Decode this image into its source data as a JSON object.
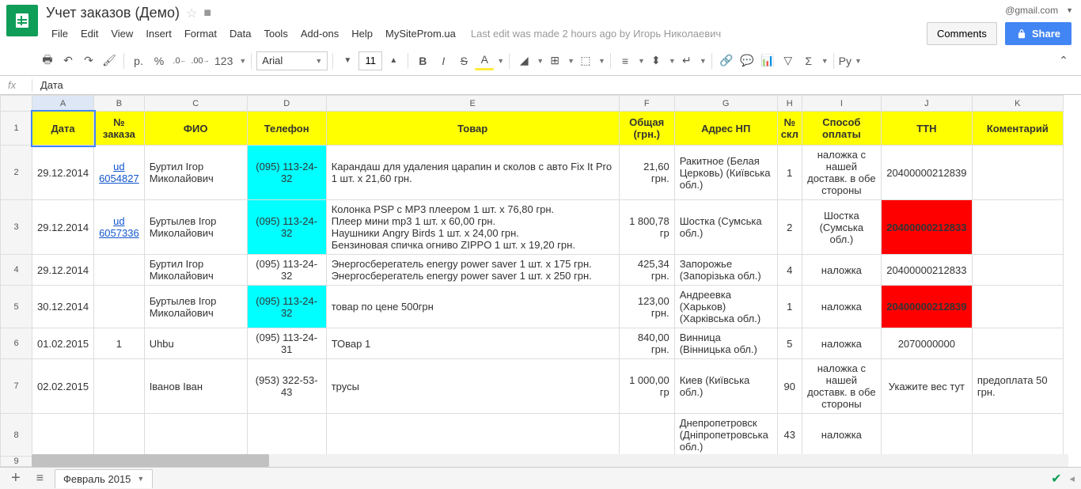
{
  "doc_title": "Учет заказов (Демо)",
  "user_email": "@gmail.com",
  "comments_label": "Comments",
  "share_label": "Share",
  "menu": [
    "File",
    "Edit",
    "View",
    "Insert",
    "Format",
    "Data",
    "Tools",
    "Add-ons",
    "Help",
    "MySiteProm.ua"
  ],
  "last_edit": "Last edit was made 2 hours ago by Игорь Николаевич",
  "font_name": "Arial",
  "font_size": "11",
  "formula_value": "Дата",
  "columns": [
    "A",
    "B",
    "C",
    "D",
    "E",
    "F",
    "G",
    "H",
    "I",
    "J",
    "K"
  ],
  "headers": [
    "Дата",
    "№ заказа",
    "ФИО",
    "Телефон",
    "Товар",
    "Общая (грн.)",
    "Адрес НП",
    "№ скл",
    "Способ оплаты",
    "ТТН",
    "Коментарий"
  ],
  "rows": [
    {
      "n": "2",
      "date": "29.12.2014",
      "order": "ud 6054827",
      "order_link": true,
      "fio": "Буртил Ігор Миколайович",
      "phone": "(095) 113-24-32",
      "phone_cyan": true,
      "goods": "Карандаш для удаления царапин и сколов с авто Fix It Pro 1 шт. x 21,60 грн.",
      "total": "21,60 грн.",
      "addr": "Ракитное (Белая Церковь) (Київська обл.)",
      "skl": "1",
      "pay": "наложка с нашей доставк. в обе стороны",
      "ttn": "20400000212839",
      "ttn_red": false,
      "comment": ""
    },
    {
      "n": "3",
      "date": "29.12.2014",
      "order": "ud 6057336",
      "order_link": true,
      "fio": "Буртылев Ігор Миколайович",
      "phone": "(095) 113-24-32",
      "phone_cyan": true,
      "goods": "Колонка PSP с MP3 плеером 1 шт. x 76,80 грн.\nПлеер мини mp3 1 шт. x 60,00 грн.\nНаушники Angry Birds 1 шт. x 24,00 грн.\nБензиновая спичка огниво ZIPPO 1 шт. x 19,20 грн.",
      "total": "1 800,78 гр",
      "addr": "Шостка (Сумська обл.)",
      "skl": "2",
      "pay": "Шостка (Сумська обл.)",
      "ttn": "20400000212833",
      "ttn_red": true,
      "comment": ""
    },
    {
      "n": "4",
      "date": "29.12.2014",
      "order": "",
      "order_link": false,
      "fio": "Буртил Ігор Миколайович",
      "phone": "(095) 113-24-32",
      "phone_cyan": false,
      "goods": "Энергосберегатель energy power saver 1 шт. x 175 грн.\nЭнергосберегатель energy power saver 1 шт. x 250 грн.",
      "total": "425,34 грн.",
      "addr": "Запорожье (Запорізька обл.)",
      "skl": "4",
      "pay": "наложка",
      "ttn": "20400000212833",
      "ttn_red": false,
      "comment": ""
    },
    {
      "n": "5",
      "date": "30.12.2014",
      "order": "",
      "order_link": false,
      "fio": "Буртылев Ігор Миколайович",
      "phone": "(095) 113-24-32",
      "phone_cyan": true,
      "goods": "товар по цене 500грн",
      "total": "123,00 грн.",
      "addr": "Андреевка (Харьков) (Харківська обл.)",
      "skl": "1",
      "pay": "наложка",
      "ttn": "20400000212839",
      "ttn_red": true,
      "comment": ""
    },
    {
      "n": "6",
      "date": "01.02.2015",
      "order": "1",
      "order_link": false,
      "fio": "Uhbu",
      "phone": "(095) 113-24-31",
      "phone_cyan": false,
      "goods": "ТОвар 1",
      "total": "840,00 грн.",
      "addr": "Винница (Вінницька обл.)",
      "skl": "5",
      "pay": "наложка",
      "ttn": "2070000000",
      "ttn_red": false,
      "comment": ""
    },
    {
      "n": "7",
      "date": "02.02.2015",
      "order": "",
      "order_link": false,
      "fio": "Іванов Іван",
      "phone": "(953) 322-53-43",
      "phone_cyan": false,
      "goods": "трусы",
      "total": "1 000,00 гр",
      "addr": "Киев (Київська обл.)",
      "skl": "90",
      "pay": "наложка с нашей доставк. в обе стороны",
      "ttn": "Укажите вес тут",
      "ttn_red": false,
      "comment": "предоплата 50 грн."
    },
    {
      "n": "8",
      "date": "",
      "order": "",
      "order_link": false,
      "fio": "",
      "phone": "",
      "phone_cyan": false,
      "goods": "",
      "total": "",
      "addr": "Днепропетровск (Дніпропетровська обл.)",
      "skl": "43",
      "pay": "наложка",
      "ttn": "",
      "ttn_red": false,
      "comment": ""
    },
    {
      "n": "9",
      "date": "",
      "order": "",
      "order_link": false,
      "fio": "",
      "phone": "",
      "phone_cyan": false,
      "goods": "",
      "total": "",
      "addr": "",
      "skl": "",
      "pay": "",
      "ttn": "",
      "ttn_red": false,
      "comment": ""
    }
  ],
  "sheet_tab": "Февраль 2015",
  "toolbar_labels": {
    "currency": "p.",
    "percent": "%",
    "dec_dec": ".0",
    "inc_dec": ".00",
    "more_fmt": "123"
  }
}
